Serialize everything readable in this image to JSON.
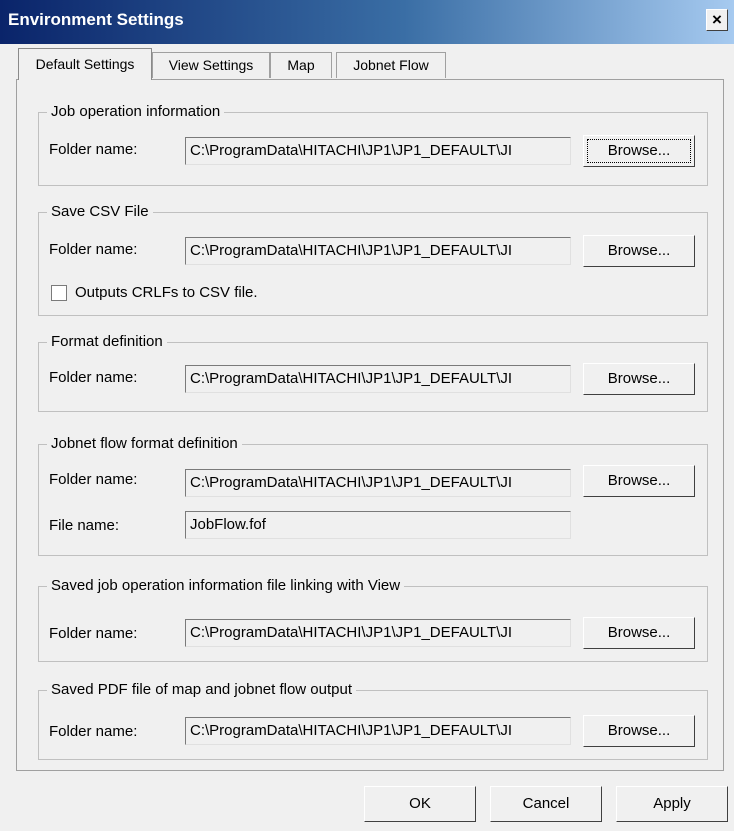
{
  "window": {
    "title": "Environment Settings",
    "close_glyph": "×"
  },
  "tabs": [
    {
      "label": "Default Settings",
      "active": true
    },
    {
      "label": "View Settings",
      "active": false
    },
    {
      "label": "Map",
      "active": false
    },
    {
      "label": "Jobnet Flow",
      "active": false
    }
  ],
  "groups": {
    "job_operation": {
      "legend": "Job operation information",
      "folder_label": "Folder name:",
      "folder_value": "C:\\ProgramData\\HITACHI\\JP1\\JP1_DEFAULT\\JI",
      "browse": "Browse..."
    },
    "save_csv": {
      "legend": "Save CSV File",
      "folder_label": "Folder name:",
      "folder_value": "C:\\ProgramData\\HITACHI\\JP1\\JP1_DEFAULT\\JI",
      "browse": "Browse...",
      "checkbox_label": "Outputs CRLFs to CSV file.",
      "checked": false
    },
    "format_def": {
      "legend": "Format definition",
      "folder_label": "Folder name:",
      "folder_value": "C:\\ProgramData\\HITACHI\\JP1\\JP1_DEFAULT\\JI",
      "browse": "Browse..."
    },
    "jobnet_flow_format": {
      "legend": "Jobnet flow format definition",
      "folder_label": "Folder name:",
      "folder_value": "C:\\ProgramData\\HITACHI\\JP1\\JP1_DEFAULT\\JI",
      "browse": "Browse...",
      "file_label": "File name:",
      "file_value": "JobFlow.fof"
    },
    "saved_job_view": {
      "legend": "Saved job operation information file linking with View",
      "folder_label": "Folder name:",
      "folder_value": "C:\\ProgramData\\HITACHI\\JP1\\JP1_DEFAULT\\JI",
      "browse": "Browse..."
    },
    "saved_pdf": {
      "legend": "Saved PDF file of map and jobnet flow output",
      "folder_label": "Folder name:",
      "folder_value": "C:\\ProgramData\\HITACHI\\JP1\\JP1_DEFAULT\\JI",
      "browse": "Browse..."
    }
  },
  "footer": {
    "ok": "OK",
    "cancel": "Cancel",
    "apply": "Apply"
  }
}
